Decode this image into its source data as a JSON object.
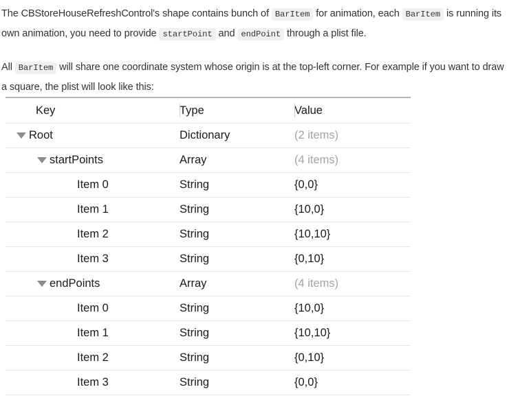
{
  "prose": {
    "paragraph1": {
      "seg1": "The CBStoreHouseRefreshControl's shape contains bunch of ",
      "code1": "BarItem",
      "seg2": " for animation, each ",
      "code2": "BarItem",
      "seg3": " is running its own animation, you need to provide ",
      "code3": "startPoint",
      "seg4": " and ",
      "code4": "endPoint",
      "seg5": " through a plist file."
    },
    "paragraph2": {
      "seg1": "All ",
      "code1": "BarItem",
      "seg2": " will share one coordinate system whose origin is at the top-left corner. For example if you want to draw a square, the plist will look like this:"
    }
  },
  "plist": {
    "columns": {
      "key": "Key",
      "type": "Type",
      "value": "Value"
    },
    "rows": [
      {
        "key": "Root",
        "type": "Dictionary",
        "value": "(2 items)",
        "indent": 0,
        "disclosure": "open",
        "muted": true
      },
      {
        "key": "startPoints",
        "type": "Array",
        "value": "(4 items)",
        "indent": 1,
        "disclosure": "open",
        "muted": true
      },
      {
        "key": "Item 0",
        "type": "String",
        "value": "{0,0}",
        "indent": 2,
        "disclosure": "none",
        "muted": false
      },
      {
        "key": "Item 1",
        "type": "String",
        "value": "{10,0}",
        "indent": 2,
        "disclosure": "none",
        "muted": false
      },
      {
        "key": "Item 2",
        "type": "String",
        "value": "{10,10}",
        "indent": 2,
        "disclosure": "none",
        "muted": false
      },
      {
        "key": "Item 3",
        "type": "String",
        "value": "{0,10}",
        "indent": 2,
        "disclosure": "none",
        "muted": false
      },
      {
        "key": "endPoints",
        "type": "Array",
        "value": "(4 items)",
        "indent": 1,
        "disclosure": "open",
        "muted": true
      },
      {
        "key": "Item 0",
        "type": "String",
        "value": "{10,0}",
        "indent": 2,
        "disclosure": "none",
        "muted": false
      },
      {
        "key": "Item 1",
        "type": "String",
        "value": "{10,10}",
        "indent": 2,
        "disclosure": "none",
        "muted": false
      },
      {
        "key": "Item 2",
        "type": "String",
        "value": "{0,10}",
        "indent": 2,
        "disclosure": "none",
        "muted": false
      },
      {
        "key": "Item 3",
        "type": "String",
        "value": "{0,0}",
        "indent": 2,
        "disclosure": "none",
        "muted": false
      }
    ]
  },
  "colors": {
    "text": "#333333",
    "table_text": "#1a1a1a",
    "muted": "#a4a4a4",
    "code_bg": "#f0f0f0",
    "rule": "#e6e6e6",
    "rule_top": "#b4b4b4",
    "triangle": "#8c8c8c"
  }
}
